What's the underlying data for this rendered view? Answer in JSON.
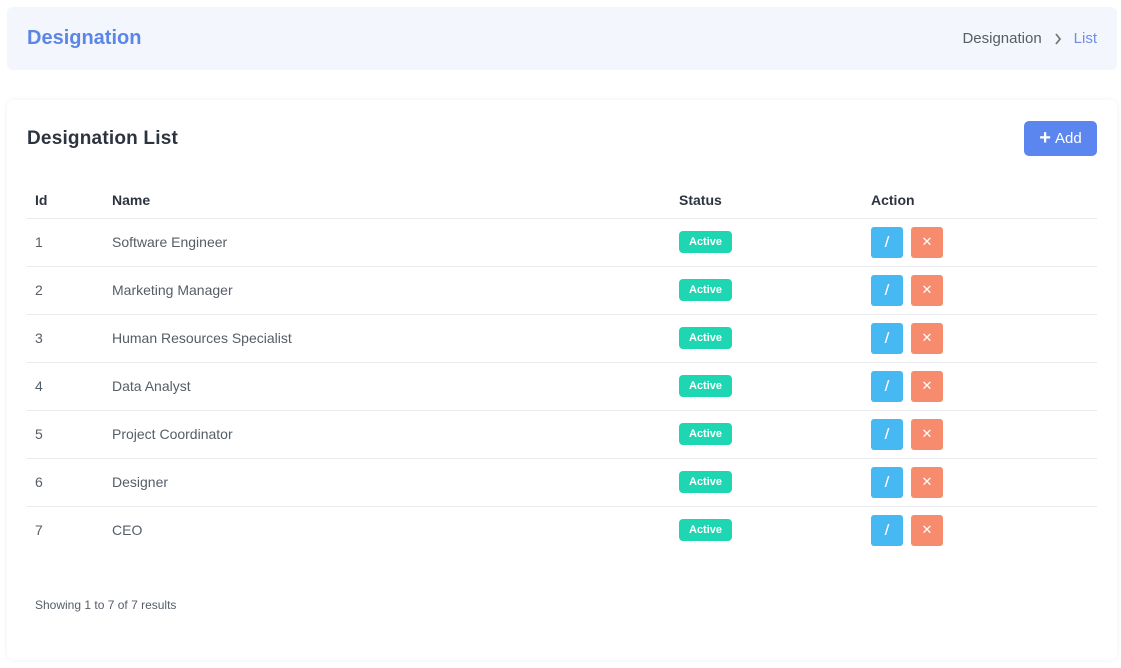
{
  "header": {
    "title": "Designation",
    "breadcrumb": {
      "parent": "Designation",
      "current": "List"
    }
  },
  "card": {
    "title": "Designation List",
    "add_label": "Add"
  },
  "table": {
    "columns": {
      "id": "Id",
      "name": "Name",
      "status": "Status",
      "action": "Action"
    },
    "rows": [
      {
        "id": "1",
        "name": "Software Engineer",
        "status": "Active"
      },
      {
        "id": "2",
        "name": "Marketing Manager",
        "status": "Active"
      },
      {
        "id": "3",
        "name": "Human Resources Specialist",
        "status": "Active"
      },
      {
        "id": "4",
        "name": "Data Analyst",
        "status": "Active"
      },
      {
        "id": "5",
        "name": "Project Coordinator",
        "status": "Active"
      },
      {
        "id": "6",
        "name": "Designer",
        "status": "Active"
      },
      {
        "id": "7",
        "name": "CEO",
        "status": "Active"
      }
    ]
  },
  "footer": {
    "summary": "Showing 1 to 7 of 7 results"
  },
  "colors": {
    "accent": "#5b86e5",
    "add_button": "#5b86f0",
    "status_active": "#1ed6b2",
    "edit_button": "#46b8f2",
    "delete_button": "#f78b6e"
  },
  "icons": {
    "chevron": "chevron-right-icon",
    "add": "plus-icon",
    "edit": "pencil-icon",
    "delete": "close-icon"
  }
}
